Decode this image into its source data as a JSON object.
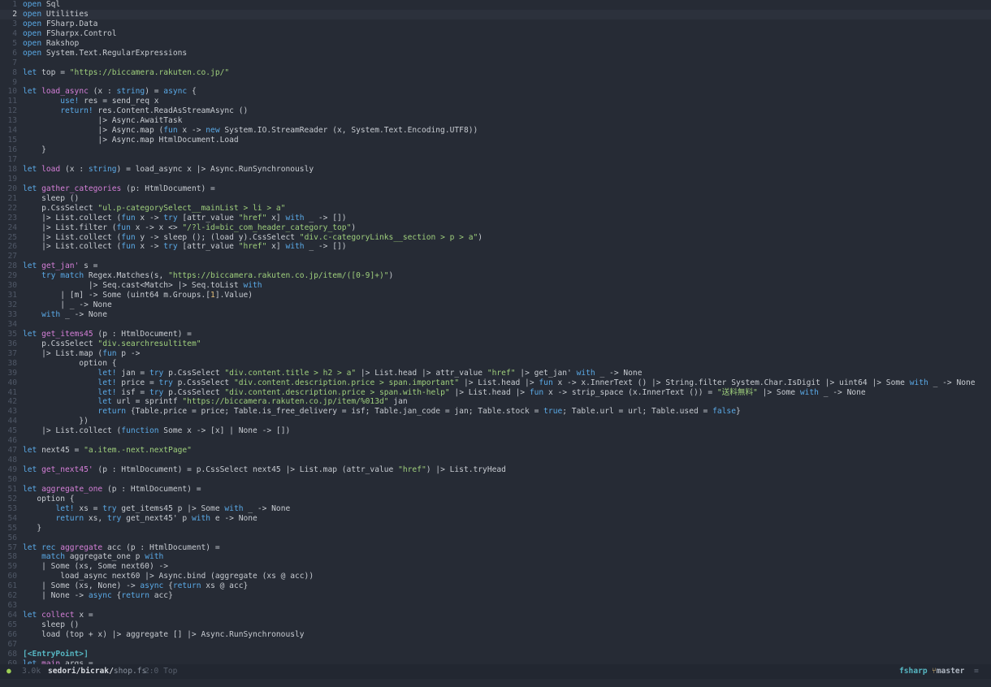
{
  "editor": {
    "current_line": 2,
    "lines": [
      [
        [
          "kw",
          "open"
        ],
        [
          "p",
          " Sql"
        ]
      ],
      [
        [
          "kw",
          "open"
        ],
        [
          "p",
          " Utilities"
        ]
      ],
      [
        [
          "kw",
          "open"
        ],
        [
          "p",
          " FSharp.Data"
        ]
      ],
      [
        [
          "kw",
          "open"
        ],
        [
          "p",
          " FSharpx.Control"
        ]
      ],
      [
        [
          "kw",
          "open"
        ],
        [
          "p",
          " Rakshop"
        ]
      ],
      [
        [
          "kw",
          "open"
        ],
        [
          "p",
          " System.Text.RegularExpressions"
        ]
      ],
      [],
      [
        [
          "kw",
          "let"
        ],
        [
          "p",
          " top = "
        ],
        [
          "str",
          "\"https://biccamera.rakuten.co.jp/\""
        ]
      ],
      [],
      [
        [
          "kw",
          "let"
        ],
        [
          "p",
          " "
        ],
        [
          "fn",
          "load_async"
        ],
        [
          "p",
          " (x : "
        ],
        [
          "kw",
          "string"
        ],
        [
          "p",
          ") = "
        ],
        [
          "kw",
          "async"
        ],
        [
          "p",
          " {"
        ]
      ],
      [
        [
          "p",
          "        "
        ],
        [
          "kw",
          "use!"
        ],
        [
          "p",
          " res = send_req x"
        ]
      ],
      [
        [
          "p",
          "        "
        ],
        [
          "kw",
          "return!"
        ],
        [
          "p",
          " res.Content.ReadAsStreamAsync ()"
        ]
      ],
      [
        [
          "p",
          "                |> Async.AwaitTask"
        ]
      ],
      [
        [
          "p",
          "                |> Async.map ("
        ],
        [
          "kw",
          "fun"
        ],
        [
          "p",
          " x -> "
        ],
        [
          "kw",
          "new"
        ],
        [
          "p",
          " System.IO.StreamReader (x, System.Text.Encoding.UTF8))"
        ]
      ],
      [
        [
          "p",
          "                |> Async.map HtmlDocument.Load"
        ]
      ],
      [
        [
          "p",
          "    }"
        ]
      ],
      [],
      [
        [
          "kw",
          "let"
        ],
        [
          "p",
          " "
        ],
        [
          "fn",
          "load"
        ],
        [
          "p",
          " (x : "
        ],
        [
          "kw",
          "string"
        ],
        [
          "p",
          ") = load_async x |> Async.RunSynchronously"
        ]
      ],
      [],
      [
        [
          "kw",
          "let"
        ],
        [
          "p",
          " "
        ],
        [
          "fn",
          "gather_categories"
        ],
        [
          "p",
          " (p: HtmlDocument) ="
        ]
      ],
      [
        [
          "p",
          "    sleep ()"
        ]
      ],
      [
        [
          "p",
          "    p.CssSelect "
        ],
        [
          "str",
          "\"ul.p-categorySelect__mainList > li > a\""
        ]
      ],
      [
        [
          "p",
          "    |> List.collect ("
        ],
        [
          "kw",
          "fun"
        ],
        [
          "p",
          " x -> "
        ],
        [
          "kw",
          "try"
        ],
        [
          "p",
          " [attr_value "
        ],
        [
          "str",
          "\"href\""
        ],
        [
          "p",
          " x] "
        ],
        [
          "kw",
          "with"
        ],
        [
          "p",
          " _ -> [])"
        ]
      ],
      [
        [
          "p",
          "    |> List.filter ("
        ],
        [
          "kw",
          "fun"
        ],
        [
          "p",
          " x -> x <> "
        ],
        [
          "str",
          "\"/?l-id=bic_com_header_category_top\""
        ],
        [
          "p",
          ")"
        ]
      ],
      [
        [
          "p",
          "    |> List.collect ("
        ],
        [
          "kw",
          "fun"
        ],
        [
          "p",
          " y -> sleep (); (load y).CssSelect "
        ],
        [
          "str",
          "\"div.c-categoryLinks__section > p > a\""
        ],
        [
          "p",
          ")"
        ]
      ],
      [
        [
          "p",
          "    |> List.collect ("
        ],
        [
          "kw",
          "fun"
        ],
        [
          "p",
          " x -> "
        ],
        [
          "kw",
          "try"
        ],
        [
          "p",
          " [attr_value "
        ],
        [
          "str",
          "\"href\""
        ],
        [
          "p",
          " x] "
        ],
        [
          "kw",
          "with"
        ],
        [
          "p",
          " _ -> [])"
        ]
      ],
      [],
      [
        [
          "kw",
          "let"
        ],
        [
          "p",
          " "
        ],
        [
          "fn",
          "get_jan'"
        ],
        [
          "p",
          " s ="
        ]
      ],
      [
        [
          "p",
          "    "
        ],
        [
          "kw",
          "try"
        ],
        [
          "p",
          " "
        ],
        [
          "kw",
          "match"
        ],
        [
          "p",
          " Regex.Matches(s, "
        ],
        [
          "str",
          "\"https://biccamera.rakuten.co.jp/item/([0-9]+)\""
        ],
        [
          "p",
          ")"
        ]
      ],
      [
        [
          "p",
          "              |> Seq.cast<Match> |> Seq.toList "
        ],
        [
          "kw",
          "with"
        ]
      ],
      [
        [
          "p",
          "        | [m] -> Some (uint64 m.Groups.["
        ],
        [
          "num",
          "1"
        ],
        [
          "p",
          "].Value)"
        ]
      ],
      [
        [
          "p",
          "        | _ -> None"
        ]
      ],
      [
        [
          "p",
          "    "
        ],
        [
          "kw",
          "with"
        ],
        [
          "p",
          " _ -> None"
        ]
      ],
      [],
      [
        [
          "kw",
          "let"
        ],
        [
          "p",
          " "
        ],
        [
          "fn",
          "get_items45"
        ],
        [
          "p",
          " (p : HtmlDocument) ="
        ]
      ],
      [
        [
          "p",
          "    p.CssSelect "
        ],
        [
          "str",
          "\"div.searchresultitem\""
        ]
      ],
      [
        [
          "p",
          "    |> List.map ("
        ],
        [
          "kw",
          "fun"
        ],
        [
          "p",
          " p ->"
        ]
      ],
      [
        [
          "p",
          "            option {"
        ]
      ],
      [
        [
          "p",
          "                "
        ],
        [
          "kw",
          "let!"
        ],
        [
          "p",
          " jan = "
        ],
        [
          "kw",
          "try"
        ],
        [
          "p",
          " p.CssSelect "
        ],
        [
          "str",
          "\"div.content.title > h2 > a\""
        ],
        [
          "p",
          " |> List.head |> attr_value "
        ],
        [
          "str",
          "\"href\""
        ],
        [
          "p",
          " |> get_jan' "
        ],
        [
          "kw",
          "with"
        ],
        [
          "p",
          " _ -> None"
        ]
      ],
      [
        [
          "p",
          "                "
        ],
        [
          "kw",
          "let!"
        ],
        [
          "p",
          " price = "
        ],
        [
          "kw",
          "try"
        ],
        [
          "p",
          " p.CssSelect "
        ],
        [
          "str",
          "\"div.content.description.price > span.important\""
        ],
        [
          "p",
          " |> List.head |> "
        ],
        [
          "kw",
          "fun"
        ],
        [
          "p",
          " x -> x.InnerText () |> String.filter System.Char.IsDigit |> uint64 |> Some "
        ],
        [
          "kw",
          "with"
        ],
        [
          "p",
          " _ -> None"
        ]
      ],
      [
        [
          "p",
          "                "
        ],
        [
          "kw",
          "let!"
        ],
        [
          "p",
          " isf = "
        ],
        [
          "kw",
          "try"
        ],
        [
          "p",
          " p.CssSelect "
        ],
        [
          "str",
          "\"div.content.description.price > span.with-help\""
        ],
        [
          "p",
          " |> List.head |> "
        ],
        [
          "kw",
          "fun"
        ],
        [
          "p",
          " x -> strip_space (x.InnerText ()) = "
        ],
        [
          "str",
          "\"送料無料\""
        ],
        [
          "p",
          " |> Some "
        ],
        [
          "kw",
          "with"
        ],
        [
          "p",
          " _ -> None"
        ]
      ],
      [
        [
          "p",
          "                "
        ],
        [
          "kw",
          "let"
        ],
        [
          "p",
          " url = sprintf "
        ],
        [
          "str",
          "\"https://biccamera.rakuten.co.jp/item/%013d\""
        ],
        [
          "p",
          " jan"
        ]
      ],
      [
        [
          "p",
          "                "
        ],
        [
          "kw",
          "return"
        ],
        [
          "p",
          " {Table.price = price; Table.is_free_delivery = isf; Table.jan_code = jan; Table.stock = "
        ],
        [
          "kw",
          "true"
        ],
        [
          "p",
          "; Table.url = url; Table.used = "
        ],
        [
          "kw",
          "false"
        ],
        [
          "p",
          "}"
        ]
      ],
      [
        [
          "p",
          "            })"
        ]
      ],
      [
        [
          "p",
          "    |> List.collect ("
        ],
        [
          "kw",
          "function"
        ],
        [
          "p",
          " Some x -> [x] | None -> [])"
        ]
      ],
      [],
      [
        [
          "kw",
          "let"
        ],
        [
          "p",
          " next45 = "
        ],
        [
          "str",
          "\"a.item.-next.nextPage\""
        ]
      ],
      [],
      [
        [
          "kw",
          "let"
        ],
        [
          "p",
          " "
        ],
        [
          "fn",
          "get_next45'"
        ],
        [
          "p",
          " (p : HtmlDocument) = p.CssSelect next45 |> List.map (attr_value "
        ],
        [
          "str",
          "\"href\""
        ],
        [
          "p",
          ") |> List.tryHead"
        ]
      ],
      [],
      [
        [
          "kw",
          "let"
        ],
        [
          "p",
          " "
        ],
        [
          "fn",
          "aggregate_one"
        ],
        [
          "p",
          " (p : HtmlDocument) ="
        ]
      ],
      [
        [
          "p",
          "   option {"
        ]
      ],
      [
        [
          "p",
          "       "
        ],
        [
          "kw",
          "let!"
        ],
        [
          "p",
          " xs = "
        ],
        [
          "kw",
          "try"
        ],
        [
          "p",
          " get_items45 p |> Some "
        ],
        [
          "kw",
          "with"
        ],
        [
          "p",
          " _ -> None"
        ]
      ],
      [
        [
          "p",
          "       "
        ],
        [
          "kw",
          "return"
        ],
        [
          "p",
          " xs, "
        ],
        [
          "kw",
          "try"
        ],
        [
          "p",
          " get_next45' p "
        ],
        [
          "kw",
          "with"
        ],
        [
          "p",
          " e -> None"
        ]
      ],
      [
        [
          "p",
          "   }"
        ]
      ],
      [],
      [
        [
          "kw",
          "let"
        ],
        [
          "p",
          " "
        ],
        [
          "kw",
          "rec"
        ],
        [
          "p",
          " "
        ],
        [
          "fn",
          "aggregate"
        ],
        [
          "p",
          " acc (p : HtmlDocument) ="
        ]
      ],
      [
        [
          "p",
          "    "
        ],
        [
          "kw",
          "match"
        ],
        [
          "p",
          " aggregate_one p "
        ],
        [
          "kw",
          "with"
        ]
      ],
      [
        [
          "p",
          "    | Some (xs, Some next60) ->"
        ]
      ],
      [
        [
          "p",
          "        load_async next60 |> Async.bind (aggregate (xs @ acc))"
        ]
      ],
      [
        [
          "p",
          "    | Some (xs, None) -> "
        ],
        [
          "kw",
          "async"
        ],
        [
          "p",
          " {"
        ],
        [
          "kw",
          "return"
        ],
        [
          "p",
          " xs @ acc}"
        ]
      ],
      [
        [
          "p",
          "    | None -> "
        ],
        [
          "kw",
          "async"
        ],
        [
          "p",
          " {"
        ],
        [
          "kw",
          "return"
        ],
        [
          "p",
          " acc}"
        ]
      ],
      [],
      [
        [
          "kw",
          "let"
        ],
        [
          "p",
          " "
        ],
        [
          "fn",
          "collect"
        ],
        [
          "p",
          " x ="
        ]
      ],
      [
        [
          "p",
          "    sleep ()"
        ]
      ],
      [
        [
          "p",
          "    load (top + x) |> aggregate [] |> Async.RunSynchronously"
        ]
      ],
      [],
      [
        [
          "attr",
          "[<EntryPoint>]"
        ]
      ],
      [
        [
          "kw",
          "let"
        ],
        [
          "p",
          " "
        ],
        [
          "fn",
          "main"
        ],
        [
          "p",
          " args ="
        ]
      ]
    ]
  },
  "statusbar": {
    "indicator": "●",
    "size": "3.0k",
    "dir": "sedori/bicrak/",
    "file": "shop.fs",
    "position": "2:0 Top",
    "mode": "fsharp",
    "branch_icon": "⑂",
    "branch": "master",
    "menu_icon": "≡"
  }
}
